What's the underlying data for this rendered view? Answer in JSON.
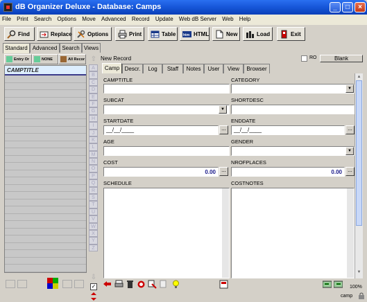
{
  "window": {
    "title": "dB Organizer Deluxe - Database: Camps",
    "minimize": "_",
    "maximize": "□",
    "close": "×"
  },
  "menu": [
    "File",
    "Print",
    "Search",
    "Options",
    "Move",
    "Advanced",
    "Record",
    "Update",
    "Web dB Server",
    "Web",
    "Help"
  ],
  "toolbar": {
    "find": "Find",
    "replace": "Replace",
    "options": "Options",
    "print": "Print",
    "table": "Table",
    "html": "HTML",
    "new": "New",
    "load": "Load",
    "exit": "Exit"
  },
  "left_tabs": [
    "Standard",
    "Advanced",
    "Search",
    "Views"
  ],
  "left_filters": {
    "entry": "Entry Or",
    "none": "NONE",
    "all": "All Recor"
  },
  "left_list": {
    "header": "CAMPTITLE"
  },
  "letters": [
    "A",
    "B",
    "C",
    "D",
    "E",
    "F",
    "G",
    "H",
    "I",
    "J",
    "K",
    "L",
    "M",
    "N",
    "O",
    "P",
    "Q",
    "R",
    "S",
    "T",
    "U",
    "V",
    "W",
    "X",
    "Y",
    "Z"
  ],
  "record": {
    "status": "New Record",
    "ro_label": "RO",
    "blank_label": "Blank"
  },
  "main_tabs": [
    "Camp",
    "Descr.",
    "Log",
    "Staff",
    "Notes",
    "User",
    "View",
    "Browser"
  ],
  "fields": {
    "camptitle": "CAMPTITLE",
    "category": "CATEGORY",
    "subcat": "SUBCAT",
    "shortdesc": "SHORTDESC",
    "startdate": "STARTDATE",
    "startdate_value": "__/__/____",
    "enddate": "ENDDATE",
    "enddate_value": "__/__/____",
    "age": "AGE",
    "gender": "GENDER",
    "cost": "COST",
    "cost_value": "0.00",
    "nrofplaces": "NROFPLACES",
    "nrofplaces_value": "0.00",
    "schedule": "SCHEDULE",
    "costnotes": "COSTNOTES"
  },
  "status": {
    "zoom": "100%",
    "table": "camp"
  }
}
